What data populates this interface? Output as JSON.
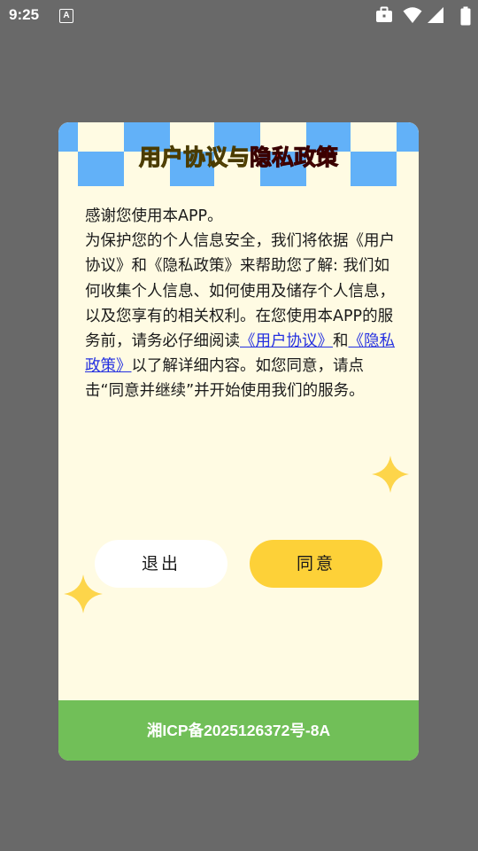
{
  "status_bar": {
    "time": "9:25",
    "notification_glyph": "A",
    "icons": [
      "briefcase-icon",
      "wifi-icon",
      "signal-icon",
      "battery-icon"
    ]
  },
  "dialog": {
    "title_part1": "用户协议",
    "title_connector": "与",
    "title_part2": "隐私政策",
    "body": {
      "p1": "感谢您使用本APP。",
      "p2": "为保护您的个人信息安全，我们将依据《用户协议》和《隐私政策》来帮助您了解: 我们如何收集个人信息、如何使用及储存个人信息，以及您享有的相关权利。在您使用本APP的服务前，请务必仔细阅读",
      "link1": "《用户协议》",
      "and": "和",
      "link2": "《隐私政策》",
      "p3": "以了解详细内容。如您同意，请点击“同意并继续”并开始使用我们的服务。"
    },
    "buttons": {
      "exit": "退出",
      "agree": "同意"
    },
    "footer": "湘ICP备2025126372号-8A",
    "colors": {
      "background": "#fffbe3",
      "checker_blue": "#62b1f8",
      "agree_button": "#fdd138",
      "footer": "#71bf58",
      "link": "#2430e0"
    }
  }
}
